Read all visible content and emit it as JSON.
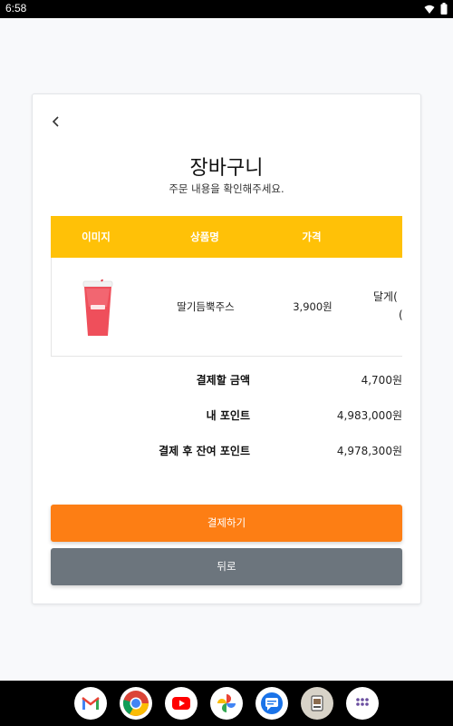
{
  "status_bar": {
    "time": "6:58"
  },
  "header": {
    "title": "장바구니",
    "subtitle": "주문 내용을 확인해주세요."
  },
  "table": {
    "columns": [
      "이미지",
      "상품명",
      "가격"
    ],
    "rows": [
      {
        "image": "strawberry-juice-image",
        "name": "딸기듬뿍주스",
        "price": "3,900원",
        "option_partial_1": "달게(",
        "option_partial_2": "("
      }
    ]
  },
  "summary": {
    "total_label": "결제할 금액",
    "total_value": "4,700원",
    "points_label": "내 포인트",
    "points_value": "4,983,000원",
    "remaining_label": "결제 후 잔여 포인트",
    "remaining_value": "4,978,300원"
  },
  "buttons": {
    "pay": "결제하기",
    "back": "뒤로"
  },
  "colors": {
    "table_header": "#ffc107",
    "pay_button": "#fd7e14",
    "back_button": "#6c757d"
  },
  "dock": [
    "gmail-icon",
    "chrome-icon",
    "youtube-icon",
    "photos-icon",
    "messages-icon",
    "app-icon",
    "app-drawer-icon"
  ]
}
